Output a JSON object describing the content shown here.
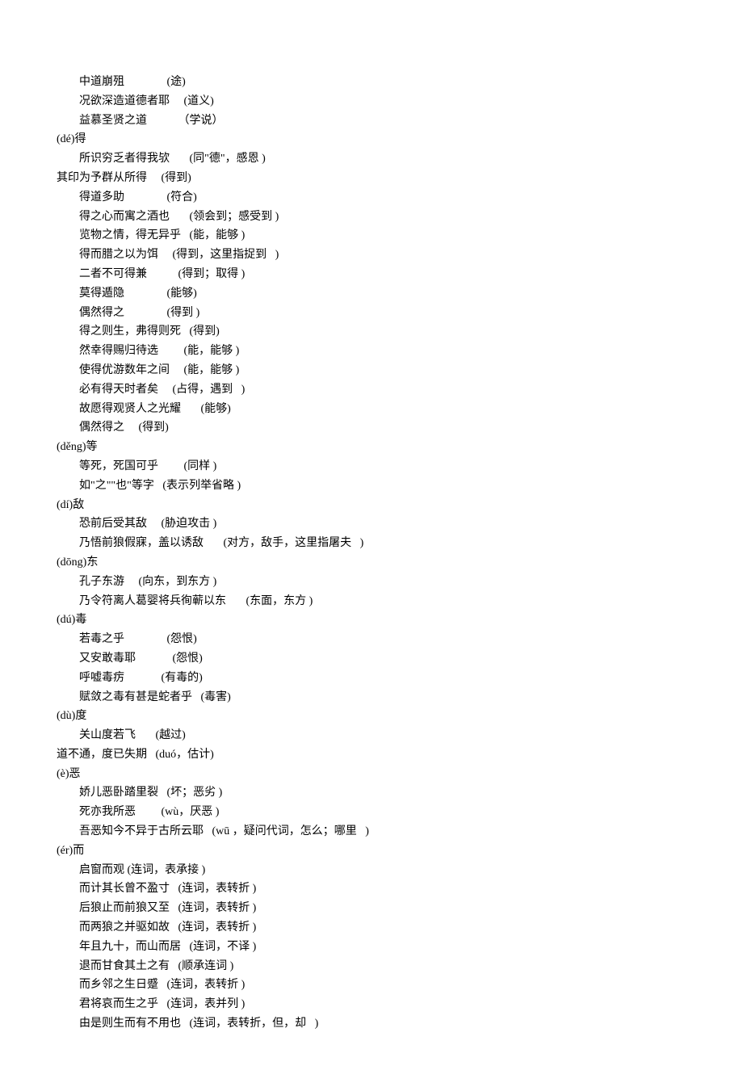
{
  "lines": [
    {
      "cls": "entry",
      "t": "中道崩殂               (途)"
    },
    {
      "cls": "entry",
      "t": "况欲深造道德者耶     (道义)"
    },
    {
      "cls": "entry",
      "t": "益慕圣贤之道           （学说）"
    },
    {
      "cls": "heading",
      "t": "(dé)得"
    },
    {
      "cls": "entry",
      "t": "所识穷乏者得我欤       (同\"德\"，感恩 )"
    },
    {
      "cls": "flush",
      "t": "其印为予群从所得     (得到)"
    },
    {
      "cls": "entry",
      "t": "得道多助               (符合)"
    },
    {
      "cls": "entry",
      "t": "得之心而寓之酒也       (领会到；感受到 )"
    },
    {
      "cls": "entry",
      "t": "览物之情，得无异乎   (能，能够 )"
    },
    {
      "cls": "entry",
      "t": "得而腊之以为饵     (得到，这里指捉到   )"
    },
    {
      "cls": "entry",
      "t": "二者不可得兼           (得到；取得 )"
    },
    {
      "cls": "entry",
      "t": "莫得遁隐               (能够)"
    },
    {
      "cls": "entry",
      "t": "偶然得之               (得到 )"
    },
    {
      "cls": "entry",
      "t": "得之则生，弗得则死   (得到)"
    },
    {
      "cls": "entry",
      "t": "然幸得赐归待选         (能，能够 )"
    },
    {
      "cls": "entry",
      "t": "使得优游数年之间     (能，能够 )"
    },
    {
      "cls": "entry",
      "t": "必有得天时者矣     (占得，遇到   )"
    },
    {
      "cls": "entry",
      "t": "故愿得观贤人之光耀       (能够)"
    },
    {
      "cls": "entry",
      "t": "偶然得之     (得到)"
    },
    {
      "cls": "heading",
      "t": "(děng)等"
    },
    {
      "cls": "entry",
      "t": "等死，死国可乎         (同样 )"
    },
    {
      "cls": "entry",
      "t": "如\"之\"\"也\"等字   (表示列举省略 )"
    },
    {
      "cls": "heading",
      "t": "(dí)敌"
    },
    {
      "cls": "entry",
      "t": "恐前后受其敌     (胁迫攻击 )"
    },
    {
      "cls": "entry",
      "t": "乃悟前狼假寐，盖以诱敌       (对方，敌手，这里指屠夫   )"
    },
    {
      "cls": "heading",
      "t": "(dōng)东"
    },
    {
      "cls": "entry",
      "t": "孔子东游     (向东，到东方 )"
    },
    {
      "cls": "entry",
      "t": "乃令符离人葛婴将兵徇蕲以东       (东面，东方 )"
    },
    {
      "cls": "heading",
      "t": "(dú)毒"
    },
    {
      "cls": "entry",
      "t": "若毒之乎               (怨恨)"
    },
    {
      "cls": "entry",
      "t": "又安敢毒耶             (怨恨)"
    },
    {
      "cls": "entry",
      "t": "呼嘘毒疠             (有毒的)"
    },
    {
      "cls": "entry",
      "t": "赋敛之毒有甚是蛇者乎   (毒害)"
    },
    {
      "cls": "heading",
      "t": "(dù)度"
    },
    {
      "cls": "entry",
      "t": "关山度若飞       (越过)"
    },
    {
      "cls": "flush",
      "t": "道不通，度已失期   (duó，估计)"
    },
    {
      "cls": "heading",
      "t": "(è)恶"
    },
    {
      "cls": "entry",
      "t": "娇儿恶卧踏里裂   (坏；恶劣 )"
    },
    {
      "cls": "entry",
      "t": "死亦我所恶         (wù，厌恶 )"
    },
    {
      "cls": "entry",
      "t": "吾恶知今不异于古所云耶   (wū ，疑问代词，怎么；哪里   )"
    },
    {
      "cls": "heading",
      "t": "(ér)而"
    },
    {
      "cls": "entry",
      "t": "启窗而观 (连词，表承接 )"
    },
    {
      "cls": "entry",
      "t": "而计其长曾不盈寸   (连词，表转折 )"
    },
    {
      "cls": "entry",
      "t": "后狼止而前狼又至   (连词，表转折 )"
    },
    {
      "cls": "entry",
      "t": "而两狼之并驱如故   (连词，表转折 )"
    },
    {
      "cls": "entry",
      "t": "年且九十，而山而居   (连词，不译 )"
    },
    {
      "cls": "entry",
      "t": "退而甘食其土之有   (顺承连词 )"
    },
    {
      "cls": "entry",
      "t": "而乡邻之生日蹙   (连词，表转折 )"
    },
    {
      "cls": "entry",
      "t": "君将哀而生之乎   (连词，表并列 )"
    },
    {
      "cls": "entry",
      "t": "由是则生而有不用也   (连词，表转折，但，却   )"
    }
  ]
}
